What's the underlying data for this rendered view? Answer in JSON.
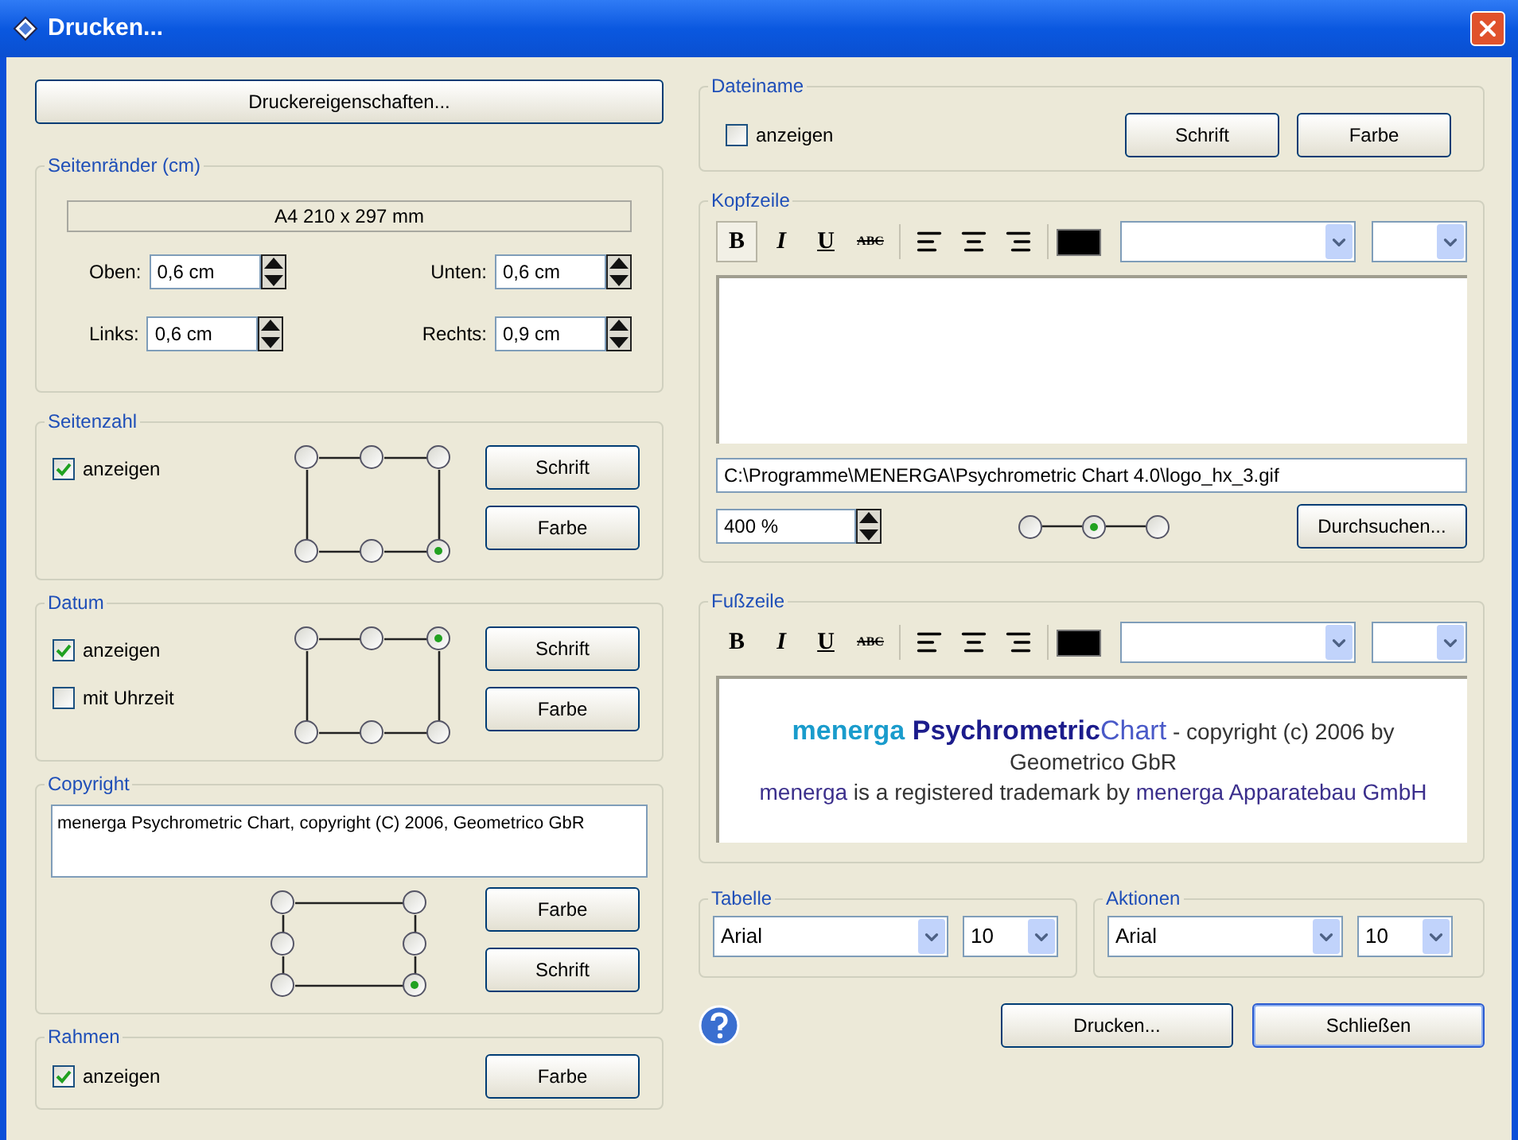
{
  "window": {
    "title": "Drucken..."
  },
  "printer_properties_button": "Druckereigenschaften...",
  "margins": {
    "title": "Seitenränder (cm)",
    "paper": "A4 210 x 297 mm",
    "fields": [
      {
        "label": "Oben:",
        "value": "0,6 cm"
      },
      {
        "label": "Unten:",
        "value": "0,6 cm"
      },
      {
        "label": "Links:",
        "value": "0,6 cm"
      },
      {
        "label": "Rechts:",
        "value": "0,9 cm"
      }
    ]
  },
  "page_number": {
    "title": "Seitenzahl",
    "options": [
      {
        "label": "anzeigen",
        "checked": true
      }
    ],
    "position": {
      "kind": "frame",
      "slots": [
        {
          "selected": false
        },
        {
          "selected": false
        },
        {
          "selected": false
        },
        {
          "selected": false
        },
        {
          "selected": false
        },
        {
          "selected": true
        }
      ]
    },
    "buttons": [
      "Schrift",
      "Farbe"
    ]
  },
  "date": {
    "title": "Datum",
    "options": [
      {
        "label": "anzeigen",
        "checked": true
      },
      {
        "label": "mit Uhrzeit",
        "checked": false
      }
    ],
    "position": {
      "kind": "frame",
      "slots": [
        {
          "selected": false
        },
        {
          "selected": false
        },
        {
          "selected": true
        },
        {
          "selected": false
        },
        {
          "selected": false
        },
        {
          "selected": false
        }
      ]
    },
    "buttons": [
      "Schrift",
      "Farbe"
    ]
  },
  "copyright": {
    "title": "Copyright",
    "text": "menerga Psychrometric Chart, copyright (C) 2006, Geometrico GbR",
    "position": {
      "kind": "sides",
      "slots": [
        {
          "selected": false
        },
        {
          "selected": false
        },
        {
          "selected": false
        },
        {
          "selected": false
        },
        {
          "selected": false
        },
        {
          "selected": true
        }
      ]
    },
    "buttons": [
      "Farbe",
      "Schrift"
    ]
  },
  "frame": {
    "title": "Rahmen",
    "options": [
      {
        "label": "anzeigen",
        "checked": true
      }
    ],
    "buttons": [
      "Farbe"
    ]
  },
  "filename": {
    "title": "Dateiname",
    "options": [
      {
        "label": "anzeigen",
        "checked": false
      }
    ],
    "buttons": [
      "Schrift",
      "Farbe"
    ]
  },
  "header": {
    "title": "Kopfzeile",
    "toolbar": {
      "styles": [
        {
          "label": "B",
          "kind": "bold",
          "selected": true
        },
        {
          "label": "I",
          "kind": "italic",
          "selected": false
        },
        {
          "label": "U",
          "kind": "underline",
          "selected": false
        },
        {
          "label": "ABC",
          "kind": "strike",
          "selected": false
        }
      ],
      "alignments": [
        {
          "kind": "left",
          "selected": false
        },
        {
          "kind": "center",
          "selected": false
        },
        {
          "kind": "right",
          "selected": false
        }
      ],
      "color": "#000000"
    },
    "path": "C:\\Programme\\MENERGA\\Psychrometric Chart 4.0\\logo_hx_3.gif",
    "zoom": "400 %",
    "position": {
      "kind": "row",
      "slots": [
        {
          "selected": false
        },
        {
          "selected": true
        },
        {
          "selected": false
        }
      ]
    },
    "browse_button": "Durchsuchen..."
  },
  "footer": {
    "title": "Fußzeile",
    "toolbar": {
      "styles": [
        {
          "label": "B",
          "kind": "bold",
          "selected": false
        },
        {
          "label": "I",
          "kind": "italic",
          "selected": false
        },
        {
          "label": "U",
          "kind": "underline",
          "selected": false
        },
        {
          "label": "ABC",
          "kind": "strike",
          "selected": false
        }
      ],
      "alignments": [
        {
          "kind": "left",
          "selected": false
        },
        {
          "kind": "center",
          "selected": false
        },
        {
          "kind": "right",
          "selected": false
        }
      ],
      "color": "#000000"
    },
    "preview": [
      [
        {
          "text": "menerga ",
          "color": "#1a9ccc",
          "bold": true,
          "large": true
        },
        {
          "text": "Psychrometric",
          "color": "#1c1c8c",
          "bold": true,
          "large": true
        },
        {
          "text": "Chart",
          "color": "#4a5ac8",
          "bold": false,
          "large": true
        },
        {
          "text": " - copyright (c) 2006 by Geometrico GbR",
          "color": "#333333",
          "bold": false,
          "large": false
        }
      ],
      [
        {
          "text": "menerga",
          "color": "#3b2f8c",
          "bold": false,
          "large": false
        },
        {
          "text": " is a registered trademark by ",
          "color": "#333333",
          "bold": false,
          "large": false
        },
        {
          "text": "menerga Apparatebau GmbH",
          "color": "#3b2f8c",
          "bold": false,
          "large": false
        }
      ]
    ]
  },
  "table_font": {
    "title": "Tabelle",
    "font": "Arial",
    "size": "10"
  },
  "actions_font": {
    "title": "Aktionen",
    "font": "Arial",
    "size": "10"
  },
  "buttons": [
    {
      "label": "Drucken...",
      "default": false
    },
    {
      "label": "Schließen",
      "default": true
    }
  ]
}
